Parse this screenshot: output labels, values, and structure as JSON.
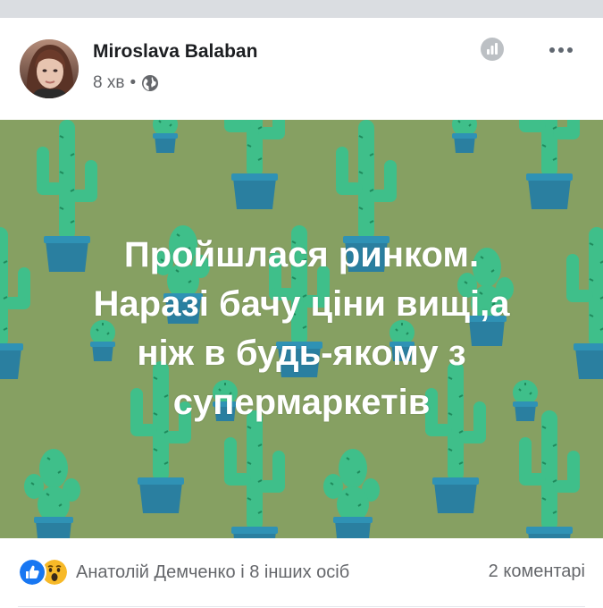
{
  "post": {
    "author": "Miroslava Balaban",
    "time": "8 хв",
    "separator": "•",
    "privacy_icon": "globe-icon",
    "insights_icon": "insights-icon",
    "more_icon": "more-options-icon"
  },
  "status": {
    "background_color": "#86a062",
    "text_color": "#ffffff",
    "lines": [
      "Пройшлася ринком.",
      "Наразі бачу ціни вищі,а",
      "ніж в будь-якому з",
      "супермаркетів"
    ]
  },
  "footer": {
    "reaction_icons": [
      "like-icon",
      "wow-icon"
    ],
    "reactions_text": "Анатолій Демченко і 8 інших осіб",
    "comments_text": "2 коментарі"
  },
  "colors": {
    "like_blue": "#1877f2",
    "wow_yellow": "#f7b928",
    "secondary_text": "#65676b",
    "cactus_green": "#3fbf8a",
    "pot_blue": "#2a7fa0"
  }
}
